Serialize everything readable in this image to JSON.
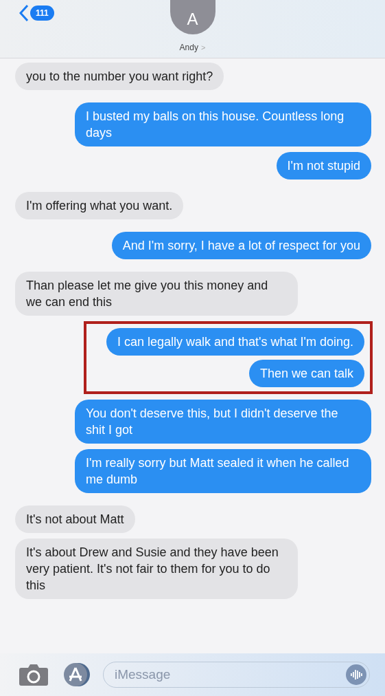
{
  "header": {
    "back_badge": "111",
    "avatar_letter": "A",
    "contact_name": "Andy",
    "contact_chevron": ">"
  },
  "messages": [
    {
      "kind": "received",
      "text": "you to the number you want right?"
    },
    {
      "kind": "sent",
      "text": "I busted my balls on this house. Countless long days"
    },
    {
      "kind": "sent",
      "text": "I'm not stupid"
    },
    {
      "kind": "received",
      "text": "I'm offering what you want."
    },
    {
      "kind": "sent",
      "text": "And I'm sorry, I have a lot of respect for you"
    },
    {
      "kind": "received",
      "text": "Than please let me give you this money and we can end this"
    },
    {
      "kind": "highlight",
      "messages": [
        {
          "kind": "sent",
          "text": "I can legally walk and that's what I'm doing."
        },
        {
          "kind": "sent",
          "text": "Then we can talk"
        }
      ]
    },
    {
      "kind": "sent",
      "text": "You don't deserve this, but I didn't deserve the shit I got"
    },
    {
      "kind": "sent",
      "text": "I'm really sorry but Matt sealed it when he called me dumb"
    },
    {
      "kind": "received",
      "text": "It's not about Matt"
    },
    {
      "kind": "received",
      "text": "It's about Drew and Susie and they have been very patient.  It's not fair to them for you to do this"
    }
  ],
  "composer": {
    "placeholder": "iMessage"
  }
}
